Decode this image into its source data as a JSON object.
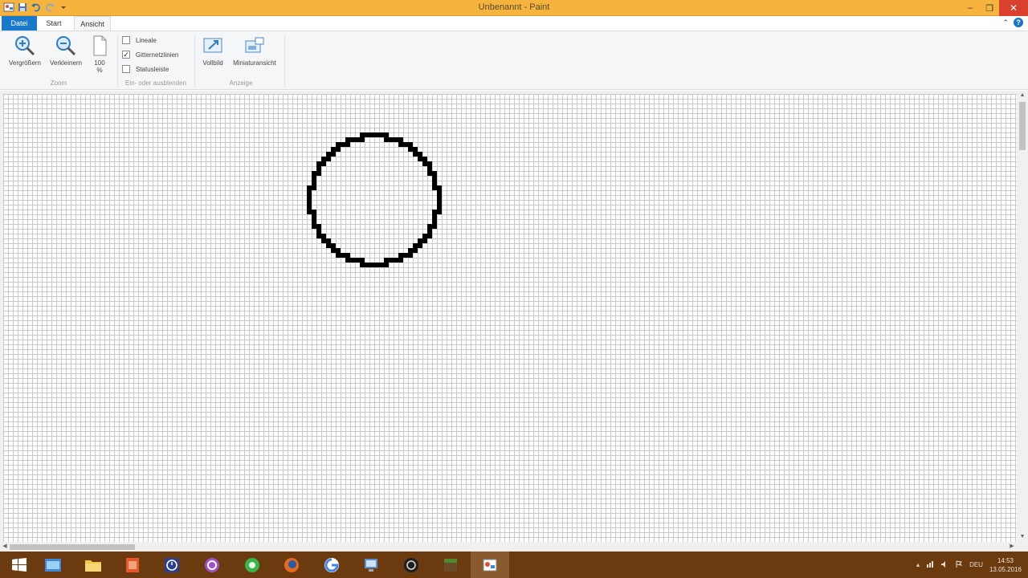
{
  "window": {
    "title": "Unbenannt - Paint",
    "minimize_glyph": "–",
    "maximize_glyph": "❐",
    "close_glyph": "✕"
  },
  "quick_access": [
    "save-icon",
    "undo-icon",
    "redo-icon",
    "customize-dropdown-icon"
  ],
  "tabs": {
    "file": "Datei",
    "start": "Start",
    "view": "Ansicht",
    "minimize_ribbon_glyph": "⌃",
    "help_glyph": "?"
  },
  "ribbon": {
    "zoom_group": {
      "label": "Zoom",
      "zoom_in": "Vergrößern",
      "zoom_out": "Verkleinern",
      "hundred_line1": "100",
      "hundred_line2": "%"
    },
    "show_group": {
      "label": "Ein- oder ausblenden",
      "rulers": {
        "label": "Lineale",
        "checked": false
      },
      "gridlines": {
        "label": "Gitternetzlinien",
        "checked": true
      },
      "statusbar": {
        "label": "Statusleiste",
        "checked": false
      },
      "check_glyph": "✓"
    },
    "display_group": {
      "label": "Anzeige",
      "fullscreen": "Vollbild",
      "thumbnail": "Miniaturansicht"
    }
  },
  "scrollbars": {
    "up_glyph": "▲",
    "down_glyph": "▼",
    "left_glyph": "◀",
    "right_glyph": "▶"
  },
  "taskbar": {
    "items": [
      "windows-start-icon",
      "file-manager-icon",
      "folder-icon",
      "office-icon",
      "clock-app-icon",
      "circle-app-icon",
      "chat-app-icon",
      "firefox-icon",
      "google-chrome-icon",
      "network-app-icon",
      "obs-icon",
      "minecraft-icon",
      "paint-icon"
    ],
    "active_item": "paint-icon",
    "tray_language": "DEU",
    "time": "14:53",
    "date": "13.05.2016"
  },
  "colors": {
    "titlebar": "#f6b43e",
    "file_tab": "#1979ca",
    "taskbar": "#6b3b0f",
    "grid": "#c9c9c9",
    "circle": "#000000"
  }
}
